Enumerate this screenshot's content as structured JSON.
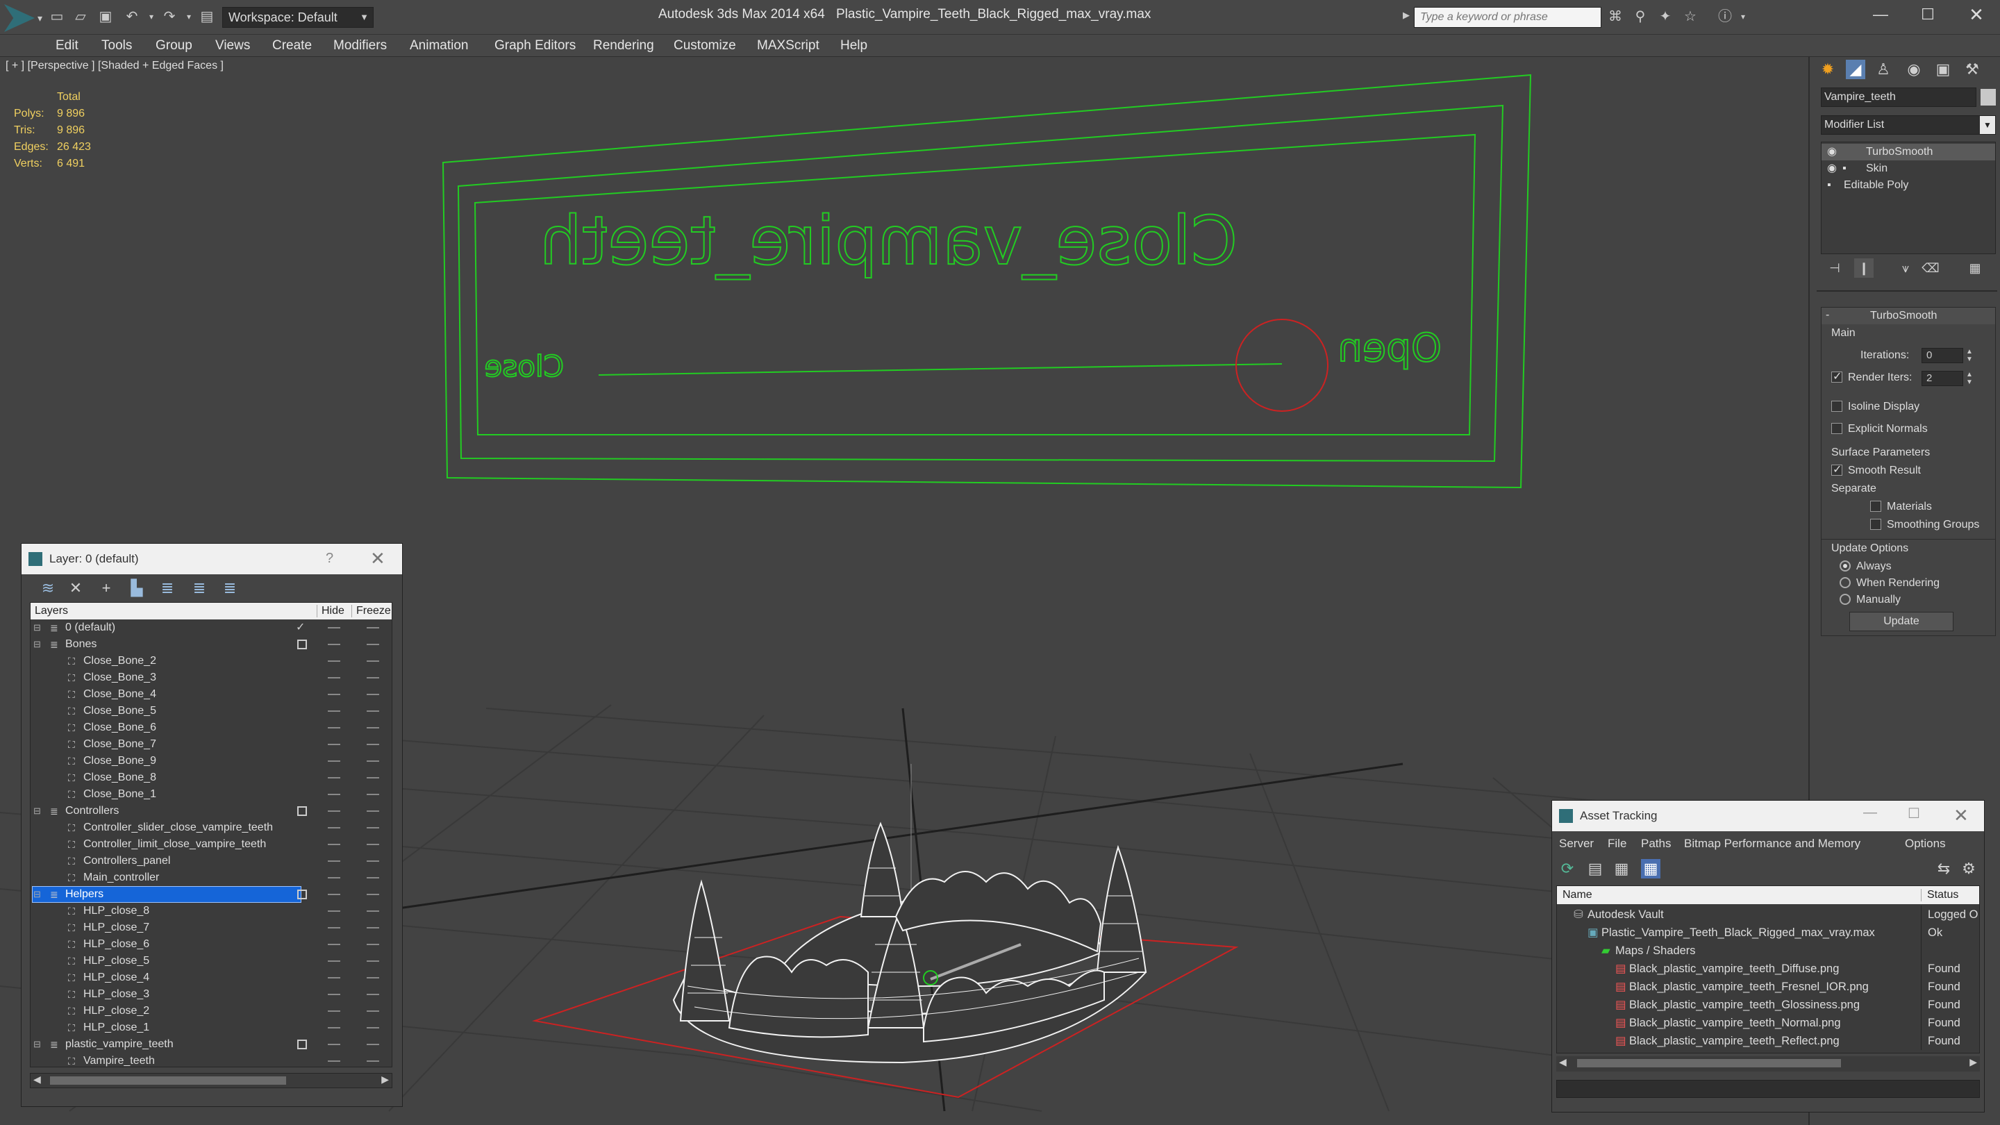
{
  "titlebar": {
    "workspace": "Workspace: Default",
    "app": "Autodesk 3ds Max  2014 x64",
    "file": "Plastic_Vampire_Teeth_Black_Rigged_max_vray.max",
    "search_placeholder": "Type a keyword or phrase"
  },
  "menu": [
    "Edit",
    "Tools",
    "Group",
    "Views",
    "Create",
    "Modifiers",
    "Animation",
    "Graph Editors",
    "Rendering",
    "Customize",
    "MAXScript",
    "Help"
  ],
  "viewport": {
    "label": "[ + ] [Perspective ] [Shaded + Edged Faces ]",
    "stats": {
      "header": "Total",
      "polys_label": "Polys:",
      "polys": "9 896",
      "tris_label": "Tris:",
      "tris": "9 896",
      "edges_label": "Edges:",
      "edges": "26 423",
      "verts_label": "Verts:",
      "verts": "6 491"
    },
    "panel_title": "Close_vampire_teeth",
    "close_label": "Close",
    "open_label": "Open"
  },
  "command_panel": {
    "object_name": "Vampire_teeth",
    "modifier_list": "Modifier List",
    "stack": [
      "TurboSmooth",
      "Skin",
      "Editable Poly"
    ],
    "rollout_title": "TurboSmooth",
    "main_label": "Main",
    "iterations_label": "Iterations:",
    "iterations": "0",
    "render_iters_label": "Render Iters:",
    "render_iters": "2",
    "isoline": "Isoline Display",
    "explicit_normals": "Explicit Normals",
    "surface_params": "Surface Parameters",
    "smooth_result": "Smooth Result",
    "separate": "Separate",
    "materials": "Materials",
    "smoothing_groups": "Smoothing Groups",
    "update_options": "Update Options",
    "always": "Always",
    "when_rendering": "When Rendering",
    "manually": "Manually",
    "update_button": "Update"
  },
  "layer_window": {
    "title": "Layer: 0 (default)",
    "help": "?",
    "col_layers": "Layers",
    "col_hide": "Hide",
    "col_freeze": "Freeze",
    "rows": [
      {
        "name": "0 (default)",
        "level": 0,
        "group": true,
        "check": true
      },
      {
        "name": "Bones",
        "level": 0,
        "group": true,
        "box": true
      },
      {
        "name": "Close_Bone_2",
        "level": 1
      },
      {
        "name": "Close_Bone_3",
        "level": 1
      },
      {
        "name": "Close_Bone_4",
        "level": 1
      },
      {
        "name": "Close_Bone_5",
        "level": 1
      },
      {
        "name": "Close_Bone_6",
        "level": 1
      },
      {
        "name": "Close_Bone_7",
        "level": 1
      },
      {
        "name": "Close_Bone_9",
        "level": 1
      },
      {
        "name": "Close_Bone_8",
        "level": 1
      },
      {
        "name": "Close_Bone_1",
        "level": 1
      },
      {
        "name": "Controllers",
        "level": 0,
        "group": true,
        "box": true
      },
      {
        "name": "Controller_slider_close_vampire_teeth",
        "level": 1
      },
      {
        "name": "Controller_limit_close_vampire_teeth",
        "level": 1
      },
      {
        "name": "Controllers_panel",
        "level": 1
      },
      {
        "name": "Main_controller",
        "level": 1
      },
      {
        "name": "Helpers",
        "level": 0,
        "group": true,
        "box": true,
        "selected": true
      },
      {
        "name": "HLP_close_8",
        "level": 1
      },
      {
        "name": "HLP_close_7",
        "level": 1
      },
      {
        "name": "HLP_close_6",
        "level": 1
      },
      {
        "name": "HLP_close_5",
        "level": 1
      },
      {
        "name": "HLP_close_4",
        "level": 1
      },
      {
        "name": "HLP_close_3",
        "level": 1
      },
      {
        "name": "HLP_close_2",
        "level": 1
      },
      {
        "name": "HLP_close_1",
        "level": 1
      },
      {
        "name": "plastic_vampire_teeth",
        "level": 0,
        "group": true,
        "box": true
      },
      {
        "name": "Vampire_teeth",
        "level": 1
      }
    ]
  },
  "asset_tracking": {
    "title": "Asset Tracking",
    "menu": [
      "Server",
      "File",
      "Paths",
      "Bitmap Performance and Memory",
      "Options"
    ],
    "col_name": "Name",
    "col_status": "Status",
    "rows": [
      {
        "name": "Autodesk Vault",
        "status": "Logged O",
        "indent": 0,
        "icon": "vault"
      },
      {
        "name": "Plastic_Vampire_Teeth_Black_Rigged_max_vray.max",
        "status": "Ok",
        "indent": 1,
        "icon": "max"
      },
      {
        "name": "Maps / Shaders",
        "status": "",
        "indent": 2,
        "icon": "folder"
      },
      {
        "name": "Black_plastic_vampire_teeth_Diffuse.png",
        "status": "Found",
        "indent": 3,
        "icon": "png"
      },
      {
        "name": "Black_plastic_vampire_teeth_Fresnel_IOR.png",
        "status": "Found",
        "indent": 3,
        "icon": "png"
      },
      {
        "name": "Black_plastic_vampire_teeth_Glossiness.png",
        "status": "Found",
        "indent": 3,
        "icon": "png"
      },
      {
        "name": "Black_plastic_vampire_teeth_Normal.png",
        "status": "Found",
        "indent": 3,
        "icon": "png"
      },
      {
        "name": "Black_plastic_vampire_teeth_Reflect.png",
        "status": "Found",
        "indent": 3,
        "icon": "png"
      }
    ]
  },
  "colors": {
    "accent": "#1565d8",
    "wire_green": "#22cc22",
    "wire_red": "#cc2222"
  }
}
